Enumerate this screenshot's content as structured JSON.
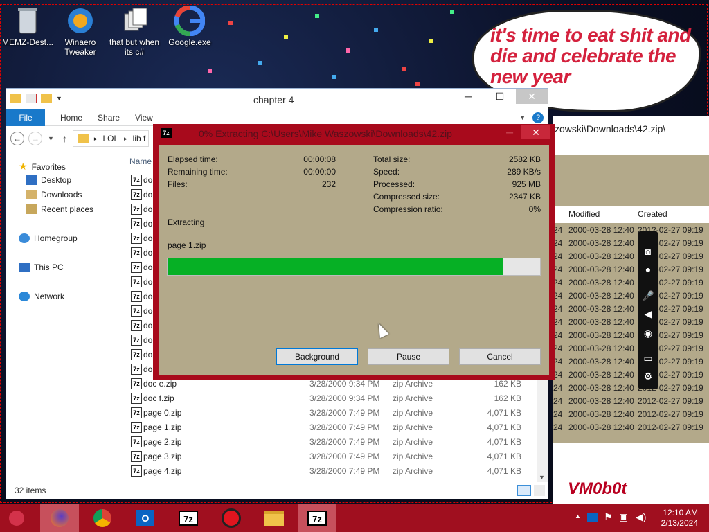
{
  "desktop": {
    "icons": [
      {
        "label": "MEMZ-Dest...",
        "icon": "recycle-bin-icon"
      },
      {
        "label": "Winaero Tweaker",
        "icon": "winaero-icon"
      },
      {
        "label": "that but when its c#",
        "icon": "shortcut-stack-icon"
      },
      {
        "label": "Google.exe",
        "icon": "google-icon"
      }
    ],
    "bubble_text": "it's time to eat shit and die and celebrate the new year"
  },
  "explorer": {
    "title": "chapter 4",
    "tabs": [
      "File",
      "Home",
      "Share",
      "View"
    ],
    "address": [
      "LOL",
      "lib f"
    ],
    "column_name": "Name",
    "nav": [
      {
        "label": "Favorites",
        "icon": "star-icon"
      },
      {
        "label": "Desktop",
        "icon": "desktop-icon"
      },
      {
        "label": "Downloads",
        "icon": "downloads-icon"
      },
      {
        "label": "Recent places",
        "icon": "recent-places-icon"
      },
      {
        "label": "Homegroup",
        "icon": "homegroup-icon"
      },
      {
        "label": "This PC",
        "icon": "this-pc-icon"
      },
      {
        "label": "Network",
        "icon": "network-icon"
      }
    ],
    "hidden_rows": [
      "doc",
      "doc",
      "doc",
      "doc",
      "doc",
      "doc",
      "doc",
      "doc",
      "doc",
      "doc",
      "doc",
      "doc",
      "doc",
      "doc"
    ],
    "files": [
      {
        "name": "doc e.zip",
        "date": "3/28/2000 9:34 PM",
        "type": "zip Archive",
        "size": "162 KB"
      },
      {
        "name": "doc f.zip",
        "date": "3/28/2000 9:34 PM",
        "type": "zip Archive",
        "size": "162 KB"
      },
      {
        "name": "page 0.zip",
        "date": "3/28/2000 7:49 PM",
        "type": "zip Archive",
        "size": "4,071 KB"
      },
      {
        "name": "page 1.zip",
        "date": "3/28/2000 7:49 PM",
        "type": "zip Archive",
        "size": "4,071 KB"
      },
      {
        "name": "page 2.zip",
        "date": "3/28/2000 7:49 PM",
        "type": "zip Archive",
        "size": "4,071 KB"
      },
      {
        "name": "page 3.zip",
        "date": "3/28/2000 7:49 PM",
        "type": "zip Archive",
        "size": "4,071 KB"
      },
      {
        "name": "page 4.zip",
        "date": "3/28/2000 7:49 PM",
        "type": "zip Archive",
        "size": "4,071 KB"
      }
    ],
    "status": "32 items"
  },
  "window2": {
    "address": "zowski\\Downloads\\42.zip\\",
    "col_modified": "Modified",
    "col_created": "Created",
    "rows": [
      {
        "a": "24",
        "modified": "2000-03-28 12:40",
        "created": "2012-02-27 09:19"
      },
      {
        "a": "24",
        "modified": "2000-03-28 12:40",
        "created": "2012-02-27 09:19"
      },
      {
        "a": "24",
        "modified": "2000-03-28 12:40",
        "created": "2012-02-27 09:19"
      },
      {
        "a": "24",
        "modified": "2000-03-28 12:40",
        "created": "2012-02-27 09:19"
      },
      {
        "a": "24",
        "modified": "2000-03-28 12:40",
        "created": "2012-02-27 09:19"
      },
      {
        "a": "24",
        "modified": "2000-03-28 12:40",
        "created": "2012-02-27 09:19"
      },
      {
        "a": "24",
        "modified": "2000-03-28 12:40",
        "created": "2012-02-27 09:19"
      },
      {
        "a": "24",
        "modified": "2000-03-28 12:40",
        "created": "2012-02-27 09:19"
      },
      {
        "a": "24",
        "modified": "2000-03-28 12:40",
        "created": "2012-02-27 09:19"
      },
      {
        "a": "24",
        "modified": "2000-03-28 12:40",
        "created": "2012-02-27 09:19"
      },
      {
        "a": "24",
        "modified": "2000-03-28 12:40",
        "created": "2012-02-27 09:19"
      },
      {
        "a": "24",
        "modified": "2000-03-28 12:40",
        "created": "2012-02-27 09:19"
      },
      {
        "a": "24",
        "modified": "2000-03-28 12:40",
        "created": "2012-02-27 09:19"
      },
      {
        "a": "24",
        "modified": "2000-03-28 12:40",
        "created": "2012-02-27 09:19"
      },
      {
        "a": "24",
        "modified": "2000-03-28 12:40",
        "created": "2012-02-27 09:19"
      },
      {
        "a": "24",
        "modified": "2000-03-28 12:40",
        "created": "2012-02-27 09:19"
      }
    ]
  },
  "dialog": {
    "title": "0% Extracting C:\\Users\\Mike Waszowski\\Downloads\\42.zip",
    "elapsed_label": "Elapsed time:",
    "elapsed": "00:00:08",
    "remaining_label": "Remaining time:",
    "remaining": "00:00:00",
    "files_label": "Files:",
    "files": "232",
    "total_label": "Total size:",
    "total": "2582 KB",
    "speed_label": "Speed:",
    "speed": "289 KB/s",
    "processed_label": "Processed:",
    "processed": "925 MB",
    "compressed_label": "Compressed size:",
    "compressed": "2347 KB",
    "ratio_label": "Compression ratio:",
    "ratio": "0%",
    "status": "Extracting",
    "current_file": "page 1.zip",
    "progress": 0.9,
    "buttons": {
      "background": "Background",
      "pause": "Pause",
      "cancel": "Cancel"
    }
  },
  "taskbar": {
    "apps": [
      "firefox-icon",
      "chrome-icon",
      "outlook-icon",
      "7zip-icon",
      "recorder-icon",
      "file-explorer-icon",
      "7zip-active-icon"
    ],
    "time": "12:10 AM",
    "date": "2/13/2024",
    "watermark": "VM0b0t"
  },
  "colors": {
    "accent": "#1979ca",
    "dialog_frame": "#a80a1c",
    "dialog_body": "#b3a98a",
    "progress": "#06b025",
    "taskbar": "#a00f1f"
  }
}
